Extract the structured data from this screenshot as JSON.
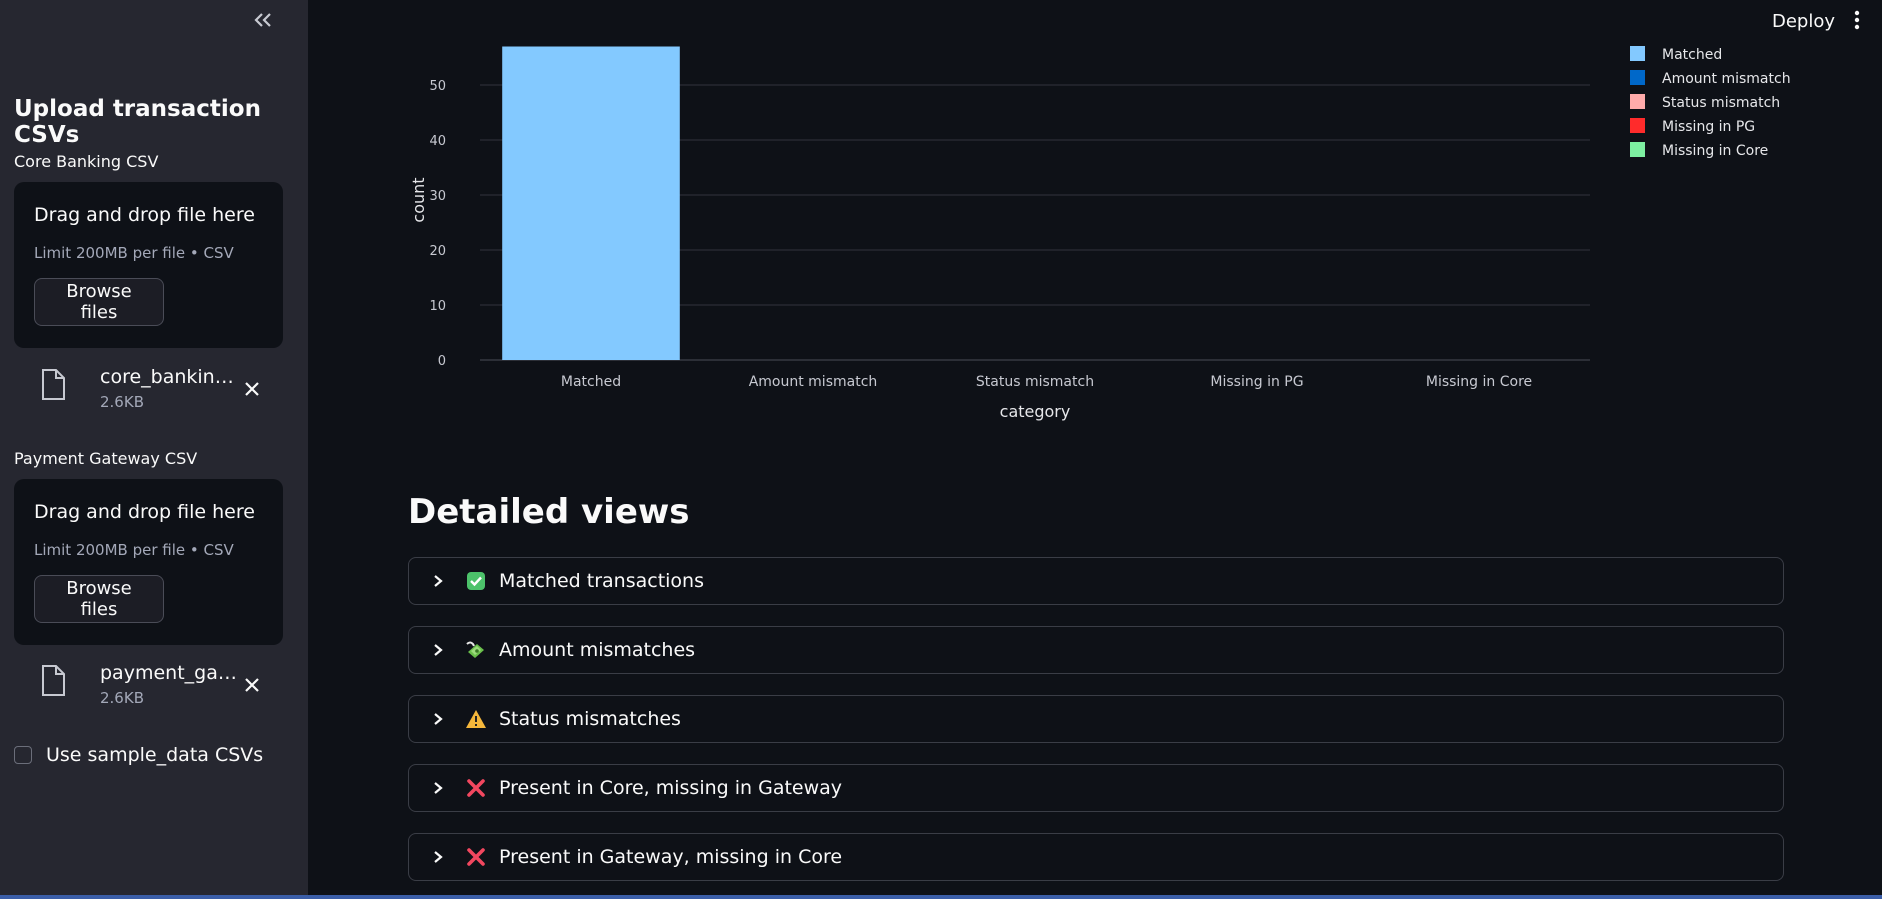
{
  "header": {
    "deploy_label": "Deploy"
  },
  "sidebar": {
    "title": "Upload transaction CSVs",
    "uploaders": [
      {
        "label": "Core Banking CSV",
        "drop_text": "Drag and drop file here",
        "limit_text": "Limit 200MB per file • CSV",
        "browse_label": "Browse files",
        "file_name": "core_banking.csv",
        "file_name_display": "core_banking....",
        "file_size": "2.6KB"
      },
      {
        "label": "Payment Gateway CSV",
        "drop_text": "Drag and drop file here",
        "limit_text": "Limit 200MB per file • CSV",
        "browse_label": "Browse files",
        "file_name_display": "payment_gat...",
        "file_size": "2.6KB"
      }
    ],
    "sample_checkbox": {
      "label": "Use sample_data CSVs",
      "checked": false
    }
  },
  "chart_data": {
    "type": "bar",
    "categories": [
      "Matched",
      "Amount mismatch",
      "Status mismatch",
      "Missing in PG",
      "Missing in Core"
    ],
    "values": [
      57,
      0,
      0,
      0,
      0
    ],
    "colors": [
      "#83c9ff",
      "#0068c9",
      "#ffabab",
      "#ff2b2b",
      "#7defa1"
    ],
    "xlabel": "category",
    "ylabel": "count",
    "yticks": [
      0,
      10,
      20,
      30,
      40,
      50
    ],
    "ylim": [
      0,
      60
    ],
    "grid": true,
    "legend": {
      "position": "top-right",
      "entries": [
        "Matched",
        "Amount mismatch",
        "Status mismatch",
        "Missing in PG",
        "Missing in Core"
      ]
    }
  },
  "detailed": {
    "title": "Detailed views",
    "expanders": [
      {
        "emoji": "check-mark-button-icon",
        "label": "Matched transactions"
      },
      {
        "emoji": "money-with-wings-icon",
        "label": "Amount mismatches"
      },
      {
        "emoji": "warning-icon",
        "label": "Status mismatches"
      },
      {
        "emoji": "cross-mark-icon",
        "label": "Present in Core, missing in Gateway"
      },
      {
        "emoji": "cross-mark-icon",
        "label": "Present in Gateway, missing in Core"
      }
    ]
  },
  "theme": {
    "background": "#0e1117",
    "sidebar": "#262730",
    "text": "#fafafa",
    "muted": "#a3a8b8"
  }
}
